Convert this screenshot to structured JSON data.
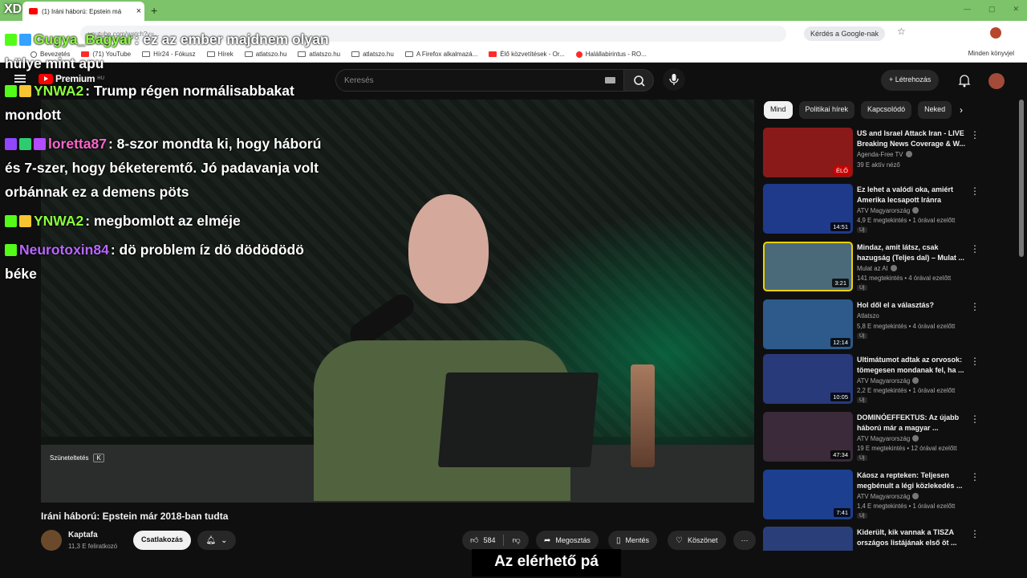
{
  "browser": {
    "tab_title": "(1) Iráni háború: Epstein má",
    "url": "youtube.com/watch?v=...",
    "ask_google": "Kérdés a Google-nak",
    "bookmarks": [
      "Bevezetés",
      "(71) YouTube",
      "Hír24 - Fókusz",
      "Hírek",
      "atlatszo.hu",
      "atlatszo.hu",
      "atlatszo.hu",
      "A Firefox alkalmazá...",
      "Élő közvetítések - Or...",
      "Halállabirintus - RO..."
    ],
    "bookmarks_right": "Minden könyvjel"
  },
  "youtube": {
    "logo_text": "Premium",
    "logo_region": "HU",
    "search_placeholder": "Keresés",
    "create_label": "Létrehozás"
  },
  "chips": [
    "Mind",
    "Politikai hírek",
    "Kapcsolódó",
    "Neked"
  ],
  "overlay": {
    "xd": "XD",
    "pause_label": "Szüneteltetés",
    "pause_key": "K"
  },
  "chat": [
    {
      "user": "Gugya_Bagyar",
      "user_color": "#8cff3c",
      "text": ": ez az ember majdnem olyan hülye mint apu"
    },
    {
      "user": "YNWA2",
      "user_color": "#8cff3c",
      "text": ": Trump régen normálisabbakat mondott"
    },
    {
      "user": "loretta87",
      "user_color": "#ff66cc",
      "text": ": 8-szor mondta ki, hogy háború és 7-szer, hogy béketeremtő. Jó padavanja volt orbánnak ez a demens pöts"
    },
    {
      "user": "YNWA2",
      "user_color": "#8cff3c",
      "text": ": megbomlott az elméje"
    },
    {
      "user": "Neurotoxin84",
      "user_color": "#b967ff",
      "text": ": dö problem íz dö dödödödö béke"
    }
  ],
  "video": {
    "title": "Iráni háború: Epstein már 2018-ban tudta",
    "channel": "Kaptafa",
    "subscribers": "11,3 E feliratkozó",
    "join_label": "Csatlakozás",
    "likes": "584",
    "share_label": "Megosztás",
    "save_label": "Mentés",
    "thanks_label": "Köszönet",
    "subtitle": "Az elérhető pá"
  },
  "related": [
    {
      "title": "US and Israel Attack Iran - LIVE Breaking News Coverage & W...",
      "channel": "Agenda-Free TV",
      "meta": "39 E aktív néző",
      "badge": "ÉLŐ",
      "is_live": true,
      "new": "",
      "thumb_color": "#8a1a1a"
    },
    {
      "title": "Ez lehet a valódi oka, amiért Amerika lecsapott Iránra",
      "channel": "ATV Magyarország",
      "meta": "4,9 E megtekintés • 1 órával ezelőtt",
      "badge": "14:51",
      "is_live": false,
      "new": "Új",
      "thumb_color": "#1f3a8a"
    },
    {
      "title": "Mindaz, amit látsz, csak hazugság (Teljes dal) – Mulat ...",
      "channel": "Mulat az AI",
      "meta": "141 megtekintés • 4 órával ezelőtt",
      "badge": "3:21",
      "is_live": false,
      "new": "Új",
      "thumb_color": "#4a6a7a"
    },
    {
      "title": "Hol dől el a választás?",
      "channel": "Atlatszo",
      "meta": "5,8 E megtekintés • 4 órával ezelőtt",
      "badge": "12:14",
      "is_live": false,
      "new": "Új",
      "thumb_color": "#2d5a8a"
    },
    {
      "title": "Ultimátumot adtak az orvosok: tömegesen mondanak fel, ha ...",
      "channel": "ATV Magyarország",
      "meta": "2,2 E megtekintés • 1 órával ezelőtt",
      "badge": "10:05",
      "is_live": false,
      "new": "Új",
      "thumb_color": "#283a7a"
    },
    {
      "title": "DOMINÓEFFEKTUS: Az újabb háború már a magyar ...",
      "channel": "ATV Magyarország",
      "meta": "19 E megtekintés • 12 órával ezelőtt",
      "badge": "47:34",
      "is_live": false,
      "new": "Új",
      "thumb_color": "#3a2a3a"
    },
    {
      "title": "Káosz a repteken: Teljesen megbénult a légi közlekedés ...",
      "channel": "ATV Magyarország",
      "meta": "1,4 E megtekintés • 1 órával ezelőtt",
      "badge": "7:41",
      "is_live": false,
      "new": "Új",
      "thumb_color": "#1d3f8f"
    },
    {
      "title": "Kiderült, kik vannak a TISZA országos listájának első öt ...",
      "channel": "ATV Magyarország",
      "meta": "",
      "badge": "",
      "is_live": false,
      "new": "",
      "thumb_color": "#2a3f7a"
    }
  ]
}
